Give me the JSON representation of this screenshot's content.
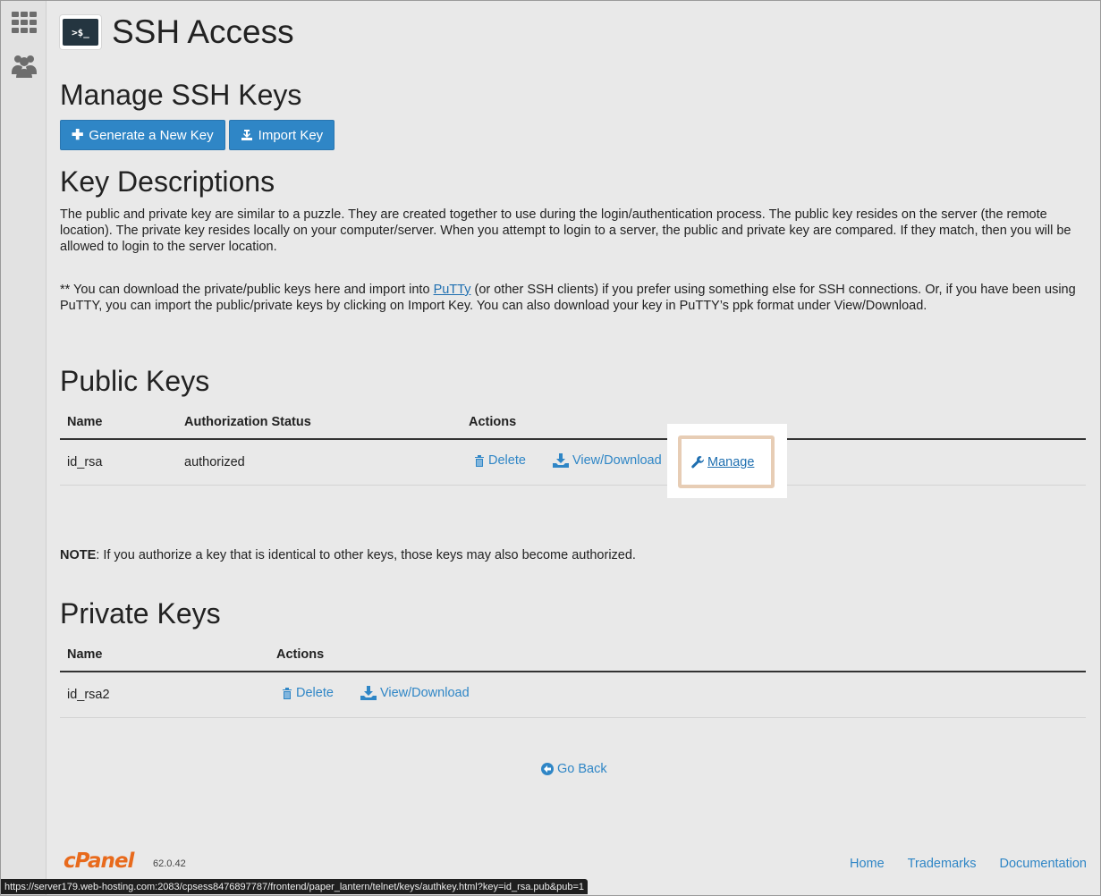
{
  "page": {
    "title": "SSH Access",
    "terminal_icon_text": ">$_"
  },
  "sidebar": {
    "items": [
      {
        "icon": "grid-icon"
      },
      {
        "icon": "users-icon"
      }
    ]
  },
  "manage_section": {
    "title": "Manage SSH Keys",
    "generate_label": "Generate a New Key",
    "import_label": "Import Key"
  },
  "descriptions": {
    "title": "Key Descriptions",
    "para1": "The public and private key are similar to a puzzle. They are created together to use during the login/authentication process. The public key resides on the server (the remote location). The private key resides locally on your computer/server. When you attempt to login to a server, the public and private key are compared. If they match, then you will be allowed to login to the server location.",
    "para2_prefix": "** You can download the private/public keys here and import into ",
    "para2_link": "PuTTy",
    "para2_suffix": " (or other SSH clients) if you prefer using something else for SSH connections. Or, if you have been using PuTTY, you can import the public/private keys by clicking on Import Key. You can also download your key in PuTTY’s ppk format under View/Download."
  },
  "public_keys": {
    "title": "Public Keys",
    "columns": [
      "Name",
      "Authorization Status",
      "Actions"
    ],
    "rows": [
      {
        "name": "id_rsa",
        "status": "authorized",
        "delete": "Delete",
        "view": "View/Download",
        "manage": "Manage"
      }
    ]
  },
  "note": {
    "label": "NOTE",
    "text": ": If you authorize a key that is identical to other keys, those keys may also become authorized."
  },
  "private_keys": {
    "title": "Private Keys",
    "columns": [
      "Name",
      "Actions"
    ],
    "rows": [
      {
        "name": "id_rsa2",
        "delete": "Delete",
        "view": "View/Download"
      }
    ]
  },
  "go_back": "Go Back",
  "footer": {
    "logo": "cPanel",
    "version": "62.0.42",
    "links": [
      "Home",
      "Trademarks",
      "Documentation"
    ]
  },
  "status_url": "https://server179.web-hosting.com:2083/cpsess8476897787/frontend/paper_lantern/telnet/keys/authkey.html?key=id_rsa.pub&pub=1",
  "colors": {
    "accent": "#2f86c6",
    "logo": "#e86a1c",
    "highlight": "#e7cdb5"
  }
}
